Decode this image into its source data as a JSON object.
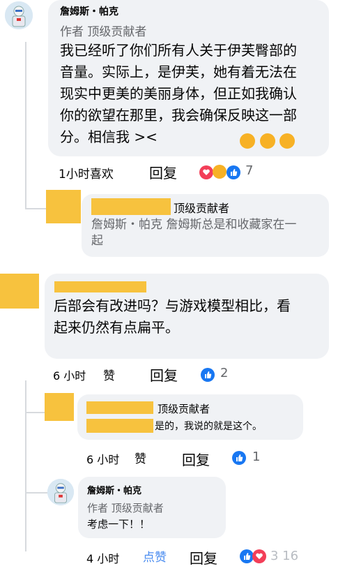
{
  "comment1": {
    "author": "詹姆斯・帕克",
    "badge": "作者 顶级贡献者",
    "lines": [
      "我已经听了你们所有人关于伊芙臀部的",
      "音量。实际上，是伊芙，她有着无法在",
      "现实中更美的美丽身体，但正如我确认",
      "你的欲望在那里，我会确保反映这一部",
      "分。相信我 ><"
    ],
    "time_like": "1小时喜欢",
    "reply": "回复",
    "reaction_count": "7"
  },
  "reply1": {
    "badge": "顶级贡献者",
    "lines": [
      "詹姆斯・帕克 詹姆斯总是和收藏家在一",
      "起"
    ]
  },
  "comment2": {
    "lines": [
      "后部会有改进吗？与游戏模型相比，看",
      "起来仍然有点扁平。"
    ],
    "time": "6 小时",
    "like": "赞",
    "reply": "回复",
    "reaction_count": "2"
  },
  "reply2": {
    "badge": "顶级贡献者",
    "text": "是的，我说的就是这个。",
    "time": "6 小时",
    "like": "赞",
    "reply": "回复",
    "reaction_count": "1"
  },
  "reply3": {
    "author": "詹姆斯・帕克",
    "badge": "作者 顶级贡献者",
    "text": "考虑一下！！",
    "time": "4 小时",
    "like": "点赞",
    "reply": "回复",
    "reaction_tail": "3 16"
  },
  "colors": {
    "bubble": "#f0f2f5",
    "redaction": "#f7c23e",
    "like_blue": "#1877f2",
    "link_blue": "#4a8cf0"
  }
}
